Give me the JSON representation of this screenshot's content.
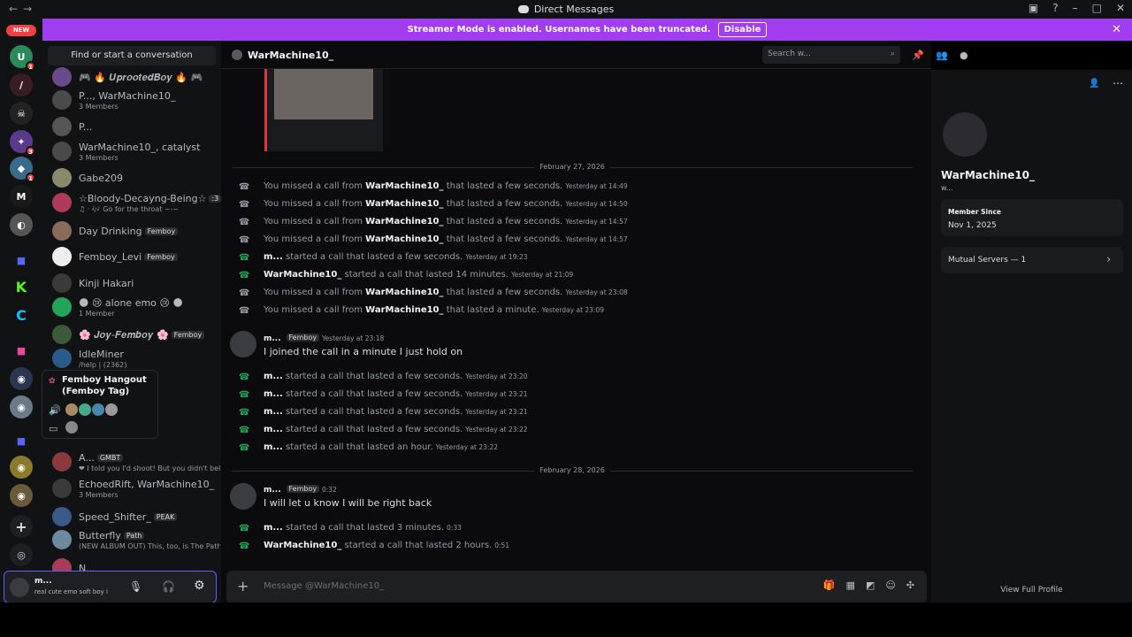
{
  "window": {
    "title": "Direct Messages"
  },
  "banner": {
    "text": "Streamer Mode is enabled. Usernames have been truncated.",
    "button": "Disable"
  },
  "guilds": {
    "new_label": "NEW",
    "badges": [
      "1",
      "3",
      "1"
    ]
  },
  "dmlist": {
    "find": "Find or start a conversation",
    "items": [
      {
        "name": "🎮 🔥 𝑼𝒑𝒓𝒐𝒐𝒕𝒆𝒅𝑩𝒐𝒚 🔥 🎮",
        "sub": "",
        "tag": ""
      },
      {
        "name": "P..., WarMachine10_",
        "sub": "3 Members",
        "tag": ""
      },
      {
        "name": "P...",
        "sub": "",
        "tag": ""
      },
      {
        "name": "WarMachine10_, catalyst",
        "sub": "3 Members",
        "tag": ""
      },
      {
        "name": "Gabe209",
        "sub": "",
        "tag": ""
      },
      {
        "name": "☆Bloody-Decayng-Being☆",
        "sub": "♫ · 🎶 Go for the throat ~-~",
        "tag": ":3"
      },
      {
        "name": "Day Drinking",
        "sub": "",
        "tag": "Femboy"
      },
      {
        "name": "Femboy_Levi",
        "sub": "",
        "tag": "Femboy"
      },
      {
        "name": "Kinji Hakari",
        "sub": "",
        "tag": ""
      },
      {
        "name": "🌑 😢 alone emo 😢 🌑",
        "sub": "1 Member",
        "tag": ""
      },
      {
        "name": "🌸 𝑱𝒐𝒚-𝑭𝒆𝒎𝒃𝒐𝒚 🌸",
        "sub": "",
        "tag": "Femboy"
      },
      {
        "name": "IdleMiner",
        "sub": "/help | (2362)",
        "tag": ""
      },
      {
        "name": "A...",
        "sub": "❤ I told you I'd shoot! But you didn't believe",
        "tag": "GMBT"
      },
      {
        "name": "EchoedRift, WarMachine10_",
        "sub": "3 Members",
        "tag": ""
      },
      {
        "name": "Speed_Shifter_",
        "sub": "",
        "tag": "PEAK"
      },
      {
        "name": "Butterfly",
        "sub": "(NEW ALBUM OUT) This, too, is The Path",
        "tag": "Path"
      },
      {
        "name": "N...",
        "sub": "",
        "tag": ""
      }
    ]
  },
  "popup": {
    "title": "Femboy Hangout",
    "subtitle": "(Femboy Tag)"
  },
  "userbar": {
    "name": "m...",
    "status": "real cute emo soft boy i"
  },
  "chat": {
    "channel": "WarMachine10_",
    "search_placeholder": "Search w...",
    "composer_placeholder": "Message @WarMachine10_",
    "sep1": "February 27, 2026",
    "sep2": "February 28, 2026",
    "missed": "You missed a call from",
    "lasted_few": "that lasted a few seconds.",
    "lasted_minute": "that lasted a minute.",
    "started_few": "started a call that lasted a few seconds.",
    "started_14": "started a call that lasted 14 minutes.",
    "started_hour": "started a call that lasted an hour.",
    "started_3": "started a call that lasted 3 minutes.",
    "started_2h": "started a call that lasted 2 hours.",
    "caller": "WarMachine10_",
    "me": "m...",
    "times": [
      "Yesterday at 14:49",
      "Yesterday at 14:50",
      "Yesterday at 14:57",
      "Yesterday at 14:57",
      "Yesterday at 19:23",
      "Yesterday at 21:09",
      "Yesterday at 23:08",
      "Yesterday at 23:09"
    ],
    "msg1": {
      "author": "m...",
      "tag": "Femboy",
      "time": "Yesterday at 23:18",
      "text": "I joined the call in a minute I just hold on"
    },
    "times2": [
      "Yesterday at 23:20",
      "Yesterday at 23:21",
      "Yesterday at 23:21",
      "Yesterday at 23:22",
      "Yesterday at 23:22"
    ],
    "msg2": {
      "author": "m...",
      "tag": "Femboy",
      "time": "0:32",
      "text": "I will let u know I will be right back"
    },
    "times3": [
      "0:33",
      "0:51"
    ]
  },
  "profile": {
    "name": "WarMachine10_",
    "sub": "w...",
    "member_since_label": "Member Since",
    "member_since": "Nov 1, 2025",
    "mutual": "Mutual Servers — 1",
    "full": "View Full Profile"
  }
}
